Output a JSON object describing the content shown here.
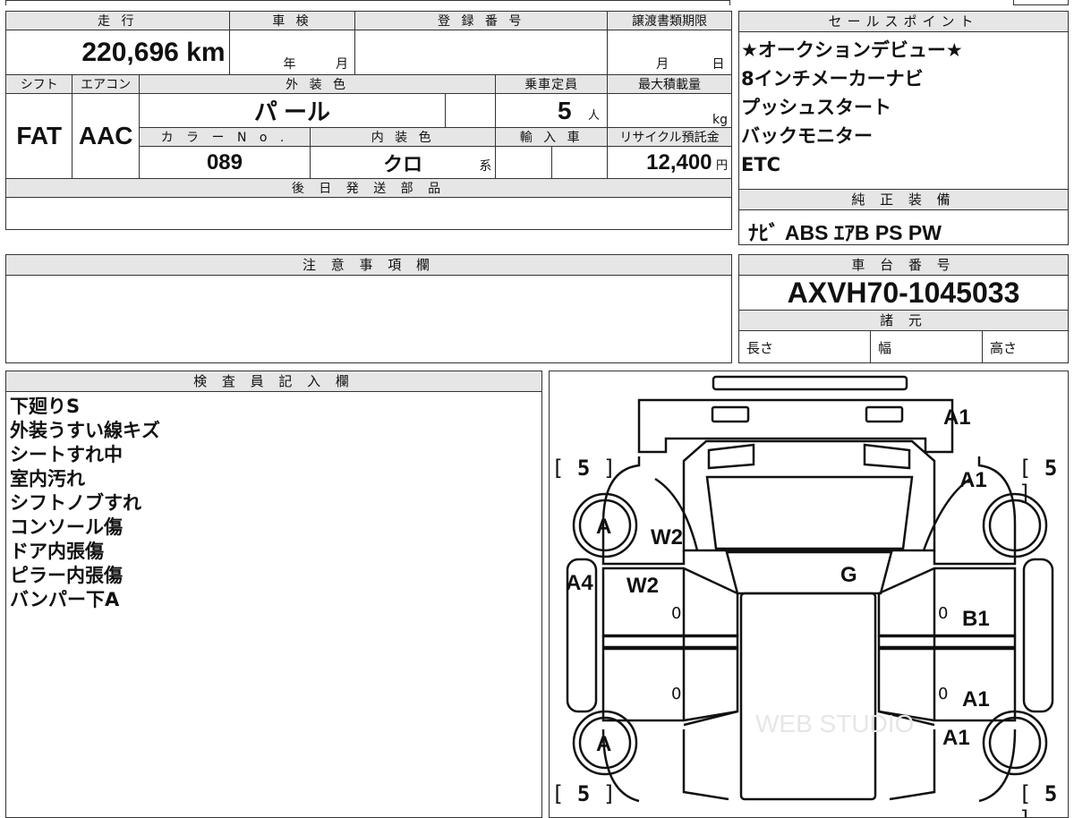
{
  "vehicle_table": {
    "mileage_label": "走 行",
    "mileage_value": "220,696 km",
    "shaken_label": "車 検",
    "shaken_year": "年",
    "shaken_month": "月",
    "reg_number_label": "登 録 番 号",
    "transfer_deadline_label": "譲渡書類期限",
    "transfer_month": "月",
    "transfer_day": "日",
    "shift_label": "シフト",
    "shift_value": "FAT",
    "aircon_label": "エアコン",
    "aircon_value": "AAC",
    "exterior_color_label": "外 装 色",
    "exterior_color_value": "パ ール",
    "capacity_label": "乗車定員",
    "capacity_value": "5",
    "capacity_unit": "人",
    "max_load_label": "最大積載量",
    "max_load_unit": "kg",
    "color_no_label": "カ ラ ー N o .",
    "color_no_value": "089",
    "interior_color_label": "内 装 色",
    "interior_color_value": "クロ",
    "interior_color_suffix": "系",
    "import_label": "輸 入 車",
    "recycle_label": "リサイクル預託金",
    "recycle_value": "12,400",
    "recycle_unit": "円",
    "later_parts_label": "後 日 発 送 部 品"
  },
  "sales_points": {
    "header": "セールスポイント",
    "lines": [
      "★オークションデビュー★",
      "8インチメーカーナビ",
      "プッシュスタート",
      "バックモニター",
      "ETC"
    ]
  },
  "genuine_equipment": {
    "header": "純 正 装 備",
    "value": "ﾅﾋﾞ ABS ｴｱB PS PW"
  },
  "notes": {
    "header": "注 意 事 項 欄"
  },
  "chassis": {
    "header": "車 台 番 号",
    "value": "AXVH70-1045033",
    "specs_header": "諸 元",
    "length_label": "長さ",
    "width_label": "幅",
    "height_label": "高さ"
  },
  "inspector": {
    "header": "検 査 員 記 入 欄",
    "lines": [
      "下廻りS",
      "外装うすい線キズ",
      "シートすれ中",
      "室内汚れ",
      "シフトノブすれ",
      "コンソール傷",
      "ドア内張傷",
      "ピラー内張傷",
      "バンパー下A"
    ]
  },
  "diagram": {
    "tire_front_left": "5",
    "tire_front_right": "5",
    "tire_rear_left": "5",
    "tire_rear_right": "5",
    "wheel_front_left": "A",
    "wheel_rear_left": "A",
    "front_bumper": "A1",
    "front_right_fender": "A1",
    "left_front_panel": "W2",
    "left_pillar": "A4",
    "left_front_door": "W2",
    "roof": "G",
    "right_front_door": "B1",
    "right_rear_door": "A1",
    "right_rear_fender": "A1",
    "door_zero_1": "0",
    "door_zero_2": "0",
    "door_zero_3": "0",
    "door_zero_4": "0",
    "watermark": "WEB STUDIO"
  }
}
